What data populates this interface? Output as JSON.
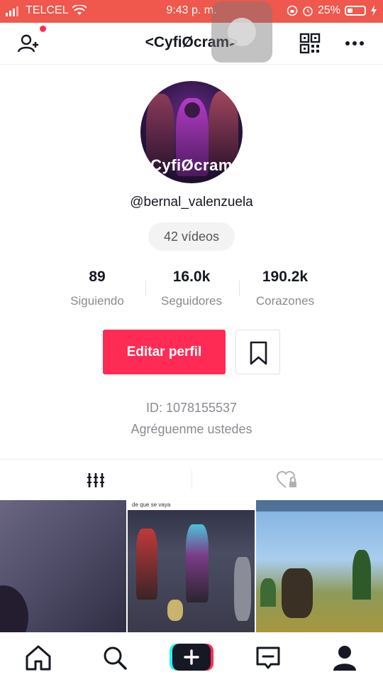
{
  "status_bar": {
    "carrier": "TELCEL",
    "time": "9:43 p. m.",
    "battery": "25%",
    "icons": [
      "signal-icon",
      "wifi-icon",
      "rotation-lock-icon",
      "alarm-icon",
      "battery-icon",
      "charging-icon"
    ]
  },
  "header": {
    "title": "<CyfiØcram>",
    "icons": [
      "add-friend-icon",
      "qr-code-icon",
      "more-icon"
    ]
  },
  "avatar": {
    "overlay_text": "CyfiØcram"
  },
  "profile": {
    "username": "@bernal_valenzuela",
    "videos": "42 vídeos"
  },
  "stats": [
    {
      "value": "89",
      "label": "Siguiendo"
    },
    {
      "value": "16.0k",
      "label": "Seguidores"
    },
    {
      "value": "190.2k",
      "label": "Corazones"
    }
  ],
  "actions": {
    "edit_label": "Editar perfil"
  },
  "id_text": "ID: 1078155537",
  "bio": "Agréguenme ustedes",
  "tabs": [
    "grid-icon",
    "liked-private-icon"
  ],
  "thumbnails": {
    "second_caption": "de que se vaya"
  },
  "nav": [
    "home-icon",
    "search-icon",
    "create-icon",
    "inbox-icon",
    "profile-icon"
  ],
  "colors": {
    "accent": "#fe2c55",
    "status_bar": "#f0574d",
    "text": "#161823",
    "secondary": "#8a8b91"
  }
}
